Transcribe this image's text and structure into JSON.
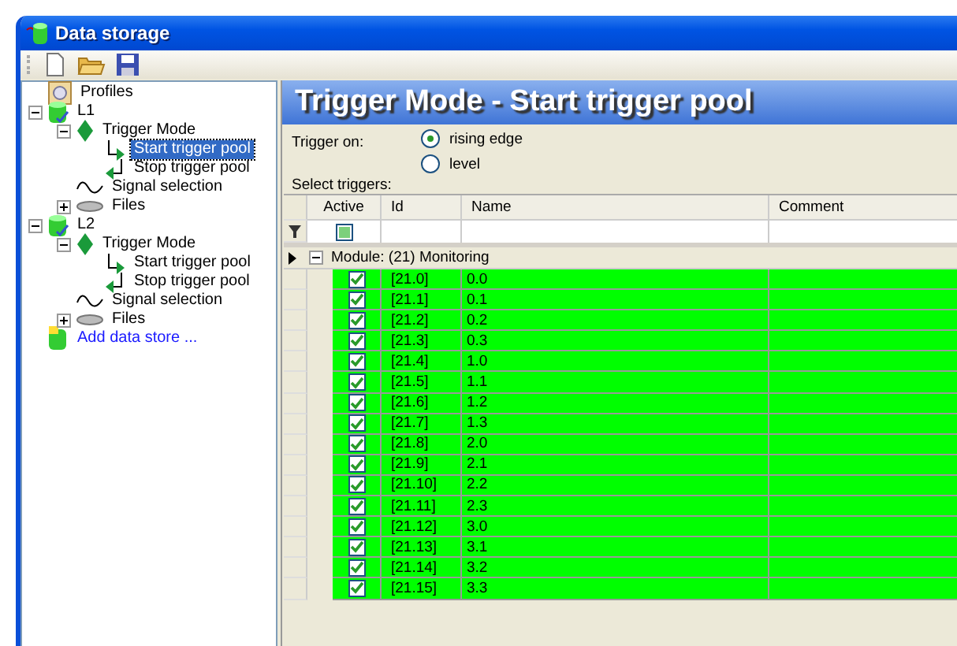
{
  "window": {
    "title": "Data storage"
  },
  "toolbar": [
    {
      "kind": "new"
    },
    {
      "kind": "open"
    },
    {
      "kind": "save"
    }
  ],
  "tree": [
    {
      "label": "Profiles",
      "kind": "profile",
      "selected": false
    },
    {
      "label": "L1",
      "kind": "store",
      "selected": false,
      "expanded": true,
      "children": [
        {
          "label": "Trigger Mode",
          "kind": "trigger",
          "selected": false,
          "expanded": true,
          "children": [
            {
              "label": "Start trigger pool",
              "kind": "start",
              "selected": true
            },
            {
              "label": "Stop trigger pool",
              "kind": "stop",
              "selected": false
            }
          ]
        },
        {
          "label": "Signal selection",
          "kind": "signal",
          "selected": false
        },
        {
          "label": "Files",
          "kind": "files",
          "selected": false,
          "expanded": false
        }
      ]
    },
    {
      "label": "L2",
      "kind": "store",
      "selected": false,
      "expanded": true,
      "children": [
        {
          "label": "Trigger Mode",
          "kind": "trigger",
          "selected": false,
          "expanded": true,
          "children": [
            {
              "label": "Start trigger pool",
              "kind": "start",
              "selected": false
            },
            {
              "label": "Stop trigger pool",
              "kind": "stop",
              "selected": false
            }
          ]
        },
        {
          "label": "Signal selection",
          "kind": "signal",
          "selected": false
        },
        {
          "label": "Files",
          "kind": "files",
          "selected": false,
          "expanded": false
        }
      ]
    },
    {
      "label": "Add data store ...",
      "kind": "add",
      "selected": false
    }
  ],
  "panel": {
    "title": "Trigger Mode - Start trigger pool",
    "trigger_label": "Trigger on:",
    "trigger_options": [
      {
        "label": "rising edge",
        "selected": true
      },
      {
        "label": "level",
        "selected": false
      }
    ],
    "select_label": "Select triggers:",
    "table": {
      "columns": [
        "Active",
        "Id",
        "Name",
        "Comment"
      ],
      "filter": {
        "partial": true
      },
      "group": {
        "label": "Module: (21) Monitoring",
        "expanded": true
      },
      "rows": [
        {
          "active": true,
          "id": "[21.0]",
          "name": "0.0"
        },
        {
          "active": true,
          "id": "[21.1]",
          "name": "0.1"
        },
        {
          "active": true,
          "id": "[21.2]",
          "name": "0.2"
        },
        {
          "active": true,
          "id": "[21.3]",
          "name": "0.3"
        },
        {
          "active": true,
          "id": "[21.4]",
          "name": "1.0"
        },
        {
          "active": true,
          "id": "[21.5]",
          "name": "1.1"
        },
        {
          "active": true,
          "id": "[21.6]",
          "name": "1.2"
        },
        {
          "active": true,
          "id": "[21.7]",
          "name": "1.3"
        },
        {
          "active": true,
          "id": "[21.8]",
          "name": "2.0"
        },
        {
          "active": true,
          "id": "[21.9]",
          "name": "2.1"
        },
        {
          "active": true,
          "id": "[21.10]",
          "name": "2.2"
        },
        {
          "active": true,
          "id": "[21.11]",
          "name": "2.3"
        },
        {
          "active": true,
          "id": "[21.12]",
          "name": "3.0"
        },
        {
          "active": true,
          "id": "[21.13]",
          "name": "3.1"
        },
        {
          "active": true,
          "id": "[21.14]",
          "name": "3.2"
        },
        {
          "active": true,
          "id": "[21.15]",
          "name": "3.3"
        }
      ]
    }
  }
}
